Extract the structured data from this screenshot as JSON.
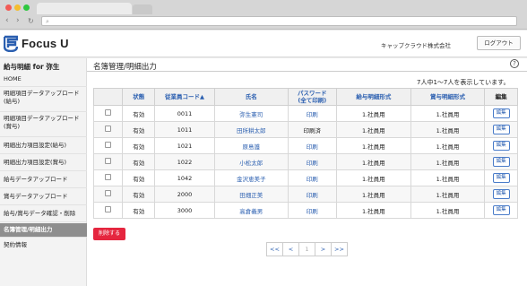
{
  "app": {
    "logo_text": "Focus U"
  },
  "header": {
    "company": "キャップクラウド株式会社",
    "logout_label": "ログアウト"
  },
  "sidebar": {
    "title": "給与明細 for 弥生",
    "items": [
      {
        "label": "HOME"
      },
      {
        "label": "明細項目データアップロード(給与)"
      },
      {
        "label": "明細項目データアップロード(賞与)"
      },
      {
        "label": "明細出力項目設定(給与)"
      },
      {
        "label": "明細出力項目設定(賞与)"
      },
      {
        "label": "給与データアップロード"
      },
      {
        "label": "賞与データアップロード"
      },
      {
        "label": "給与/賞与データ確認・削除"
      },
      {
        "label": "名簿管理/明細出力"
      },
      {
        "label": "契約情報"
      }
    ]
  },
  "main": {
    "title": "名簿管理/明細出力",
    "help_label": "?",
    "count_text": "7人中1〜7人を表示しています。",
    "columns": [
      "",
      "状態",
      "従業員コード▲",
      "氏名",
      "パスワード",
      "(全て印刷)",
      "給与明細形式",
      "賞与明細形式",
      "編集"
    ],
    "rows": [
      {
        "status": "有効",
        "code": "0011",
        "name": "弥生憲司",
        "password": "印刷",
        "salary_format": "1.社員用",
        "bonus_format": "1.社員用",
        "edit": "編集"
      },
      {
        "status": "有効",
        "code": "1011",
        "name": "田所耕太郎",
        "password": "印刷済",
        "salary_format": "1.社員用",
        "bonus_format": "1.社員用",
        "edit": "編集"
      },
      {
        "status": "有効",
        "code": "1021",
        "name": "原島護",
        "password": "印刷",
        "salary_format": "1.社員用",
        "bonus_format": "1.社員用",
        "edit": "編集"
      },
      {
        "status": "有効",
        "code": "1022",
        "name": "小松太郎",
        "password": "印刷",
        "salary_format": "1.社員用",
        "bonus_format": "1.社員用",
        "edit": "編集"
      },
      {
        "status": "有効",
        "code": "1042",
        "name": "金沢恵美子",
        "password": "印刷",
        "salary_format": "1.社員用",
        "bonus_format": "1.社員用",
        "edit": "編集"
      },
      {
        "status": "有効",
        "code": "2000",
        "name": "田畑正美",
        "password": "印刷",
        "salary_format": "1.社員用",
        "bonus_format": "1.社員用",
        "edit": "編集"
      },
      {
        "status": "有効",
        "code": "3000",
        "name": "高倉義男",
        "password": "印刷",
        "salary_format": "1.社員用",
        "bonus_format": "1.社員用",
        "edit": "編集"
      }
    ],
    "delete_label": "削除する",
    "pager": {
      "first": "<<",
      "prev": "<",
      "current": "1",
      "next": ">",
      "last": ">>"
    }
  },
  "colors": {
    "accent_blue": "#2b5fb0",
    "danger_red": "#e5263f",
    "active_sidebar": "#8e8e8e"
  }
}
